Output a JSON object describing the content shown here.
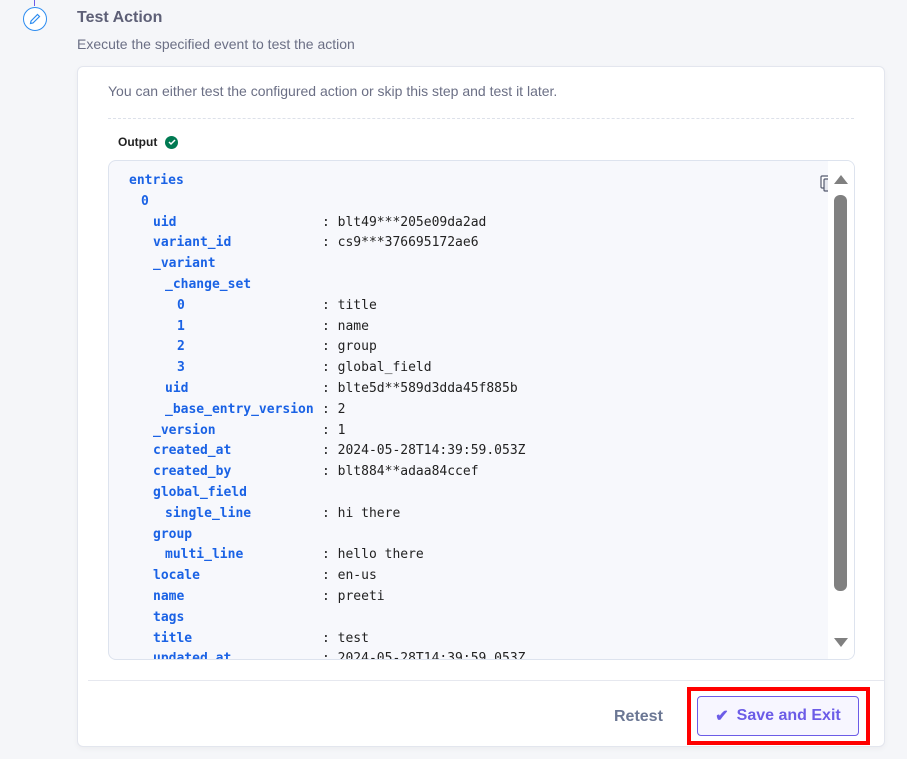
{
  "step": {
    "title": "Test Action",
    "subtitle": "Execute the specified event to test the action",
    "icon": "pencil-icon"
  },
  "card": {
    "description": "You can either test the configured action or skip this step and test it later.",
    "output_label": "Output",
    "output_status": "success",
    "rows": [
      {
        "indent": 0,
        "key": "entries",
        "value": ""
      },
      {
        "indent": 1,
        "key": "0",
        "value": ""
      },
      {
        "indent": 2,
        "key": "uid",
        "value": ": blt49***205e09da2ad"
      },
      {
        "indent": 2,
        "key": "variant_id",
        "value": ": cs9***376695172ae6"
      },
      {
        "indent": 2,
        "key": "_variant",
        "value": ""
      },
      {
        "indent": 3,
        "key": "_change_set",
        "value": ""
      },
      {
        "indent": 4,
        "key": "0",
        "value": ": title"
      },
      {
        "indent": 4,
        "key": "1",
        "value": ": name"
      },
      {
        "indent": 4,
        "key": "2",
        "value": ": group"
      },
      {
        "indent": 4,
        "key": "3",
        "value": ": global_field"
      },
      {
        "indent": 3,
        "key": "uid",
        "value": ": blte5d**589d3dda45f885b"
      },
      {
        "indent": 3,
        "key": "_base_entry_version",
        "value": ": 2"
      },
      {
        "indent": 2,
        "key": "_version",
        "value": ": 1"
      },
      {
        "indent": 2,
        "key": "created_at",
        "value": ": 2024-05-28T14:39:59.053Z"
      },
      {
        "indent": 2,
        "key": "created_by",
        "value": ": blt884**adaa84ccef"
      },
      {
        "indent": 2,
        "key": "global_field",
        "value": ""
      },
      {
        "indent": 3,
        "key": "single_line",
        "value": ": hi there"
      },
      {
        "indent": 2,
        "key": "group",
        "value": ""
      },
      {
        "indent": 3,
        "key": "multi_line",
        "value": ": hello there"
      },
      {
        "indent": 2,
        "key": "locale",
        "value": ": en-us"
      },
      {
        "indent": 2,
        "key": "name",
        "value": ": preeti"
      },
      {
        "indent": 2,
        "key": "tags",
        "value": ""
      },
      {
        "indent": 2,
        "key": "title",
        "value": ": test"
      },
      {
        "indent": 2,
        "key": "updated_at",
        "value": ": 2024-05-28T14:39:59.053Z"
      }
    ]
  },
  "footer": {
    "retest_label": "Retest",
    "save_label": "Save and Exit"
  },
  "colors": {
    "accent": "#6c5ce7",
    "key": "#1a62e5",
    "success": "#007a52",
    "highlight": "#ff0000"
  }
}
